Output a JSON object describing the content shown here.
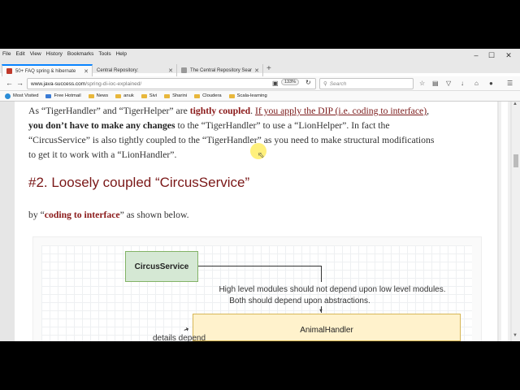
{
  "browser": {
    "menu": [
      "File",
      "Edit",
      "View",
      "History",
      "Bookmarks",
      "Tools",
      "Help"
    ],
    "tabs": [
      {
        "title": "50+ FAQ spring & hibernate",
        "active": true
      },
      {
        "title": "Central Repository:",
        "active": false
      },
      {
        "title": "The Central Repository Sear",
        "active": false
      }
    ],
    "url_host": "www.java-success.com",
    "url_path": "/spring-di-ioc-explained/",
    "zoom": "133%",
    "search_placeholder": "Search",
    "bookmarks": [
      "Most Visited",
      "Free Hotmail",
      "News",
      "anuk",
      "Sivi",
      "Sharini",
      "Cloudera",
      "Scala-learning"
    ]
  },
  "article": {
    "p1": {
      "a": "As “TigerHandler” and “TigerHelper” are ",
      "b": "tightly coupled",
      "c": ". ",
      "d": "If you apply the DIP (i.e. coding to interface)",
      "e": ",",
      "f": "you don’t have to make any changes",
      "g": " to the “TigerHandler” to use a “LionHelper”. In fact the",
      "h": "“CircusService” is also tightly coupled to the “TigerHandler” as you need to make structural modifications",
      "i": "to get it to work with a “LionHandler”."
    },
    "heading": "#2. Loosely coupled “CircusService”",
    "p2": {
      "a": "by “",
      "b": "coding to interface",
      "c": "” as shown below."
    },
    "diagram": {
      "circus_service": "CircusService",
      "note_line1": "High level modules should not depend upon low level modules.",
      "note_line2": "Both should depend upon abstractions.",
      "animal_handler": "AnimalHandler",
      "details_depend": "details depend"
    }
  }
}
